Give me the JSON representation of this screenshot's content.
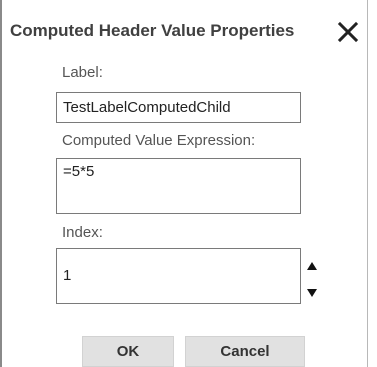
{
  "dialog": {
    "title": "Computed Header Value Properties",
    "close_icon": "close-icon"
  },
  "fields": {
    "label": {
      "caption": "Label:",
      "value": "TestLabelComputedChild"
    },
    "expression": {
      "caption": "Computed Value Expression:",
      "value": "=5*5"
    },
    "index": {
      "caption": "Index:",
      "value": "1",
      "up_icon": "spin-up-icon",
      "down_icon": "spin-down-icon"
    }
  },
  "buttons": {
    "ok": "OK",
    "cancel": "Cancel"
  }
}
